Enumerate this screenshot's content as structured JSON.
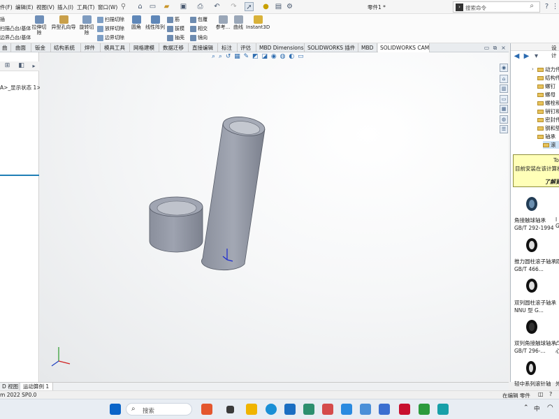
{
  "menu": {
    "items": [
      "件(F)",
      "编辑(E)",
      "视图(V)",
      "插入(I)",
      "工具(T)",
      "窗口(W)"
    ],
    "document_title": "零件1 *",
    "search_placeholder": "搜索命令"
  },
  "ribbon": {
    "left_items": [
      "插",
      "扫描凸台/基体",
      "边界凸台/基体"
    ],
    "extruded_cut": "拉伸切除",
    "hole_wizard": "异型孔向导",
    "revolved_cut": "旋转切除",
    "swept_cut": "扫描切除",
    "lofted_cut": "放样切除",
    "boundary_cut": "边界切除",
    "fillet": "圆角",
    "linear_pattern": "线性阵列",
    "rib": "筋",
    "draft": "拔模",
    "shell": "抽壳",
    "wrap": "包覆",
    "intersect": "相交",
    "mirror": "镜向",
    "reference": "参考...",
    "curves": "曲线",
    "instant3d": "Instant3D"
  },
  "tabs": [
    "曲面",
    "钣金",
    "结构系统",
    "焊件",
    "模具工具",
    "网格建模",
    "数据迁移",
    "直接编辑",
    "标注",
    "评估",
    "MBD Dimensions",
    "SOLIDWORKS 插件",
    "MBD",
    "SOLIDWORKS CAM"
  ],
  "tab_first_partial": "曲",
  "left_panel": {
    "display_state": "A>_显示状态 1>"
  },
  "right_panel": {
    "title": "设计",
    "tree": [
      "动力传",
      "结构件",
      "螺钉",
      "螺母",
      "螺栓和",
      "销钉和",
      "密封件",
      "钢和垫",
      "轴承",
      "滚"
    ],
    "tip_title": "To",
    "tip_text": "目前安装在该计算机",
    "tip_link": "了解更",
    "parts": [
      {
        "name": "角接触球轴承 GB/T 292-1994",
        "right_cut": "l G"
      },
      {
        "name": "推力圆柱滚子轴承 GB/T 466...",
        "right_cut": "双"
      },
      {
        "name": "双列圆柱滚子轴承 NNU 型 G...",
        "right_cut": ""
      },
      {
        "name": "双列角接触球轴承 GB/T 296-...",
        "right_cut": "凸 心"
      },
      {
        "name": "轻中系列滚针轴",
        "right_cut": "外"
      }
    ]
  },
  "model_tabs": [
    "D 视图",
    "运动算例 1"
  ],
  "status": {
    "left": "m 2022 SP0.0",
    "right": "在编辑 零件"
  },
  "taskbar": {
    "search": "搜索",
    "tray_lang": "中"
  },
  "viewport": {
    "view_orientation": "isometric"
  }
}
